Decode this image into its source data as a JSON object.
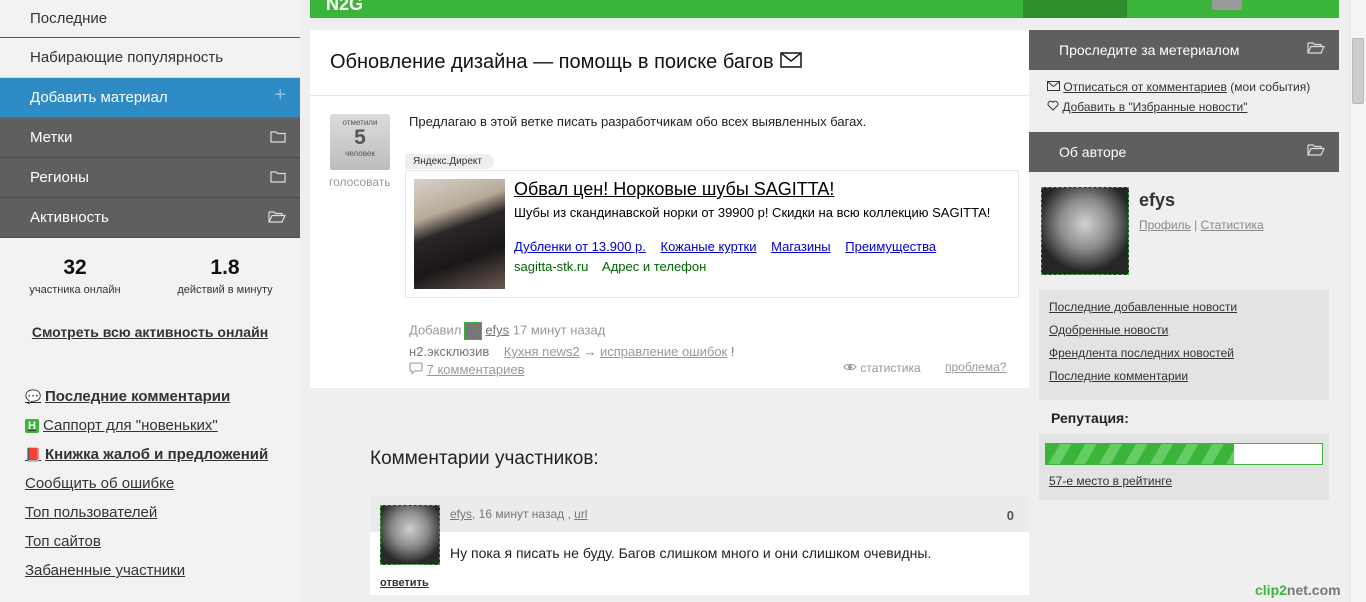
{
  "nav": {
    "items": [
      {
        "label": "Последние"
      },
      {
        "label": "Набирающие популярность"
      },
      {
        "label": "Добавить материал",
        "icon": "plus-icon"
      },
      {
        "label": "Метки",
        "icon": "folder-icon"
      },
      {
        "label": "Регионы",
        "icon": "folder-icon"
      },
      {
        "label": "Активность",
        "icon": "folder-open-icon"
      }
    ]
  },
  "activity": {
    "online_count": "32",
    "online_label": "участника онлайн",
    "rate": "1.8",
    "rate_label": "действий в минуту",
    "see_all": "Смотреть всю активность онлайн"
  },
  "side_links": [
    {
      "label": "Последние комментарии",
      "icon": "comments-icon"
    },
    {
      "label": "Саппорт для \"новеньких\"",
      "icon": "h-badge-icon",
      "badge": "H"
    },
    {
      "label": "Книжка жалоб и предложений",
      "icon": "book-icon"
    },
    {
      "label": "Сообщить об ошибке"
    },
    {
      "label": "Топ пользователей"
    },
    {
      "label": "Топ сайтов"
    },
    {
      "label": "Забаненные участники"
    }
  ],
  "post": {
    "title": "Обновление дизайна — помощь в поиске багов",
    "vote_top": "отметили",
    "vote_count": "5",
    "vote_unit": "человек",
    "vote_label": "голосовать",
    "text": "Предлагаю в этой ветке писать разработчикам обо всех выявленных багах.",
    "added_label": "Добавил",
    "author": "efys",
    "time": "17 минут назад",
    "category": "н2.эксклюзив",
    "section": "Кухня news2",
    "arrow": "→",
    "subsection": "исправление ошибок",
    "excl": "!",
    "comments_link": "7 комментариев",
    "stats_link": "статистика",
    "problem_link": "проблема?"
  },
  "ad": {
    "tag": "Яндекс.Директ",
    "title": "Обвал цен! Норковые шубы SAGITTA!",
    "description": "Шубы из скандинавской норки от 39900 р! Скидки на всю коллекцию SAGITTA!",
    "links": [
      "Дубленки от 13.900 р.",
      "Кожаные куртки",
      "Магазины",
      "Преимущества"
    ],
    "site": "sagitta-stk.ru",
    "contact": "Адрес и телефон"
  },
  "comments": {
    "heading": "Комментарии участников:",
    "items": [
      {
        "author": "efys",
        "time": ", 16 минут назад ,",
        "url": "url",
        "score": "0",
        "text": "Ну пока я писать не буду. Багов слишком много и они слишком очевидны.",
        "reply": "ответить"
      }
    ]
  },
  "right": {
    "follow_title": "Проследите за метериалом",
    "unsubscribe": "Отписаться от комментариев",
    "my_events": "(мои события)",
    "add_fav": "Добавить в \"Избранные новости\"",
    "about_title": "Об авторе",
    "author_name": "efys",
    "profile": "Профиль",
    "sep": "|",
    "statistics": "Статистика",
    "author_links": [
      "Последние добавленные новости",
      "Одобренные новости",
      "Френдлента последних новостей",
      "Последние комментарии"
    ],
    "reputation_label": "Репутация:",
    "reputation_fill": 0.68,
    "rank": "57-е место в рейтинге"
  },
  "watermark": {
    "a": "clip2",
    "b": "net.com"
  },
  "colors": {
    "accent_green": "#3bb43a",
    "active_blue": "#2f8bc4",
    "dark_gray": "#5f5f5f"
  }
}
